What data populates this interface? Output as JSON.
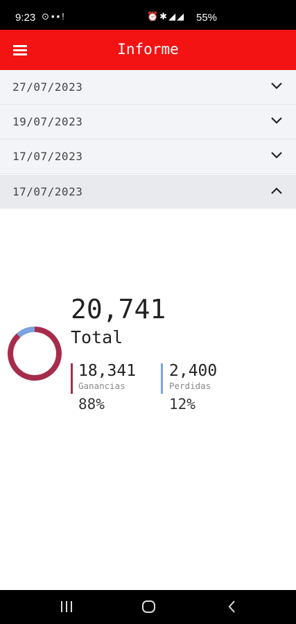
{
  "status_bar": {
    "time": "9:23",
    "battery": "55%"
  },
  "app_bar": {
    "title": "Informe"
  },
  "panels": [
    {
      "date": "27/07/2023",
      "expanded": false
    },
    {
      "date": "19/07/2023",
      "expanded": false
    },
    {
      "date": "17/07/2023",
      "expanded": false
    },
    {
      "date": "17/07/2023",
      "expanded": true
    }
  ],
  "summary": {
    "total_value": "20,741",
    "total_label": "Total",
    "gains": {
      "value": "18,341",
      "label": "Ganancias",
      "percent": "88%",
      "color": "#a72c4b"
    },
    "losses": {
      "value": "2,400",
      "label": "Perdidas",
      "percent": "12%",
      "color": "#7aa3e0"
    }
  },
  "chart_data": {
    "type": "pie",
    "categories": [
      "Ganancias",
      "Perdidas"
    ],
    "values": [
      18341,
      2400
    ],
    "colors": [
      "#a72c4b",
      "#7aa3e0"
    ]
  },
  "colors": {
    "app_bar": "#f31313",
    "panel_bg": "#f3f4f8"
  }
}
